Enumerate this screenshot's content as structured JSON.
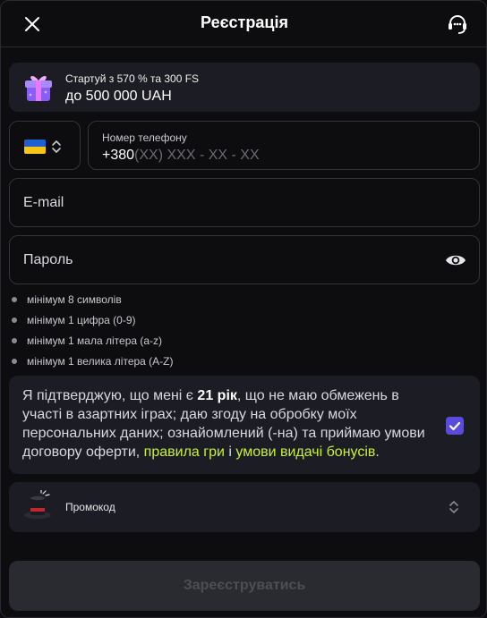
{
  "header": {
    "title": "Реєстрація"
  },
  "promo": {
    "line1": "Стартуй з 570 % та 300 FS",
    "line2": "до 500 000 UAH"
  },
  "phone": {
    "label": "Номер телефону",
    "prefix": "+380",
    "placeholder": "(XX) XXX - XX - XX"
  },
  "email": {
    "placeholder": "E-mail"
  },
  "password": {
    "placeholder": "Пароль"
  },
  "password_rules": [
    "мінімум 8 символів",
    "мінімум 1 цифра (0-9)",
    "мінімум 1 мала літера (a-z)",
    "мінімум 1 велика літера (A-Z)"
  ],
  "consent": {
    "part1": "Я підтверджую, що мені є ",
    "age": "21 рік",
    "part2": ", що не маю обмежень в участі в азартних іграх; даю згоду на обробку моїх персональних даних; ознайомлений (-на) та приймаю умови договору оферти, ",
    "link1": "правила гри",
    "and": " і ",
    "link2": "умови видачі бонусів",
    "end": ".",
    "checked": true
  },
  "promocode": {
    "label": "Промокод"
  },
  "submit": {
    "label": "Зареєструватись"
  },
  "colors": {
    "accent": "#5b4bdb",
    "link": "#c8f036",
    "card": "#1c1c24",
    "background": "#0d0d10"
  },
  "icons": {
    "close": "close-icon",
    "support": "headset-icon",
    "gift": "gift-icon",
    "flag": "ukraine-flag-icon",
    "eye": "eye-icon",
    "hat": "magic-hat-icon"
  }
}
